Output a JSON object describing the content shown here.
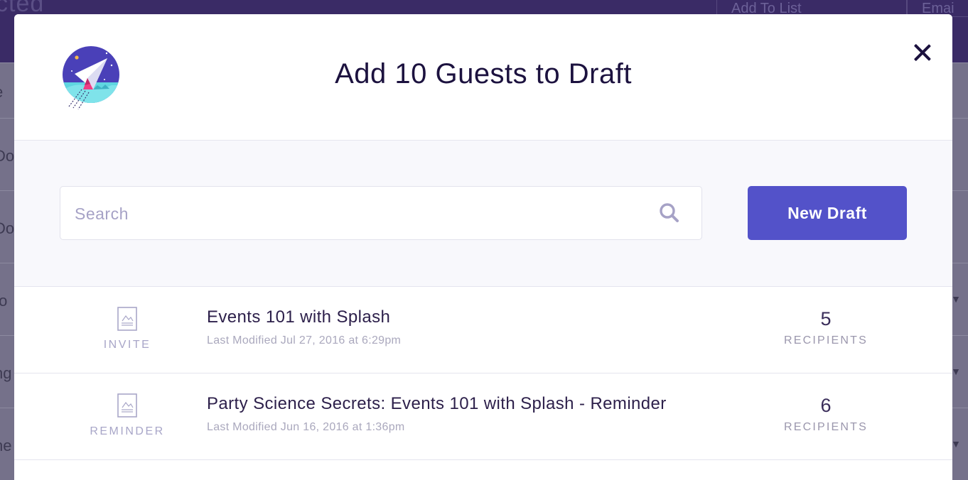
{
  "background": {
    "title_fragment": "cted",
    "add_to_list_button": "Add To List",
    "email_button": "Emai",
    "rows": [
      "e",
      "Do",
      "Do",
      "to",
      "ng",
      "ne"
    ]
  },
  "modal": {
    "title": "Add 10 Guests to Draft",
    "logo_icon": "paper-plane-rocket-icon",
    "close_icon": "close-icon",
    "search": {
      "placeholder": "Search",
      "value": "",
      "icon": "search-icon"
    },
    "new_draft_label": "New Draft",
    "drafts": [
      {
        "type": "INVITE",
        "icon": "document-image-icon",
        "title": "Events 101 with Splash",
        "modified": "Last Modified Jul 27, 2016 at 6:29pm",
        "recipient_count": "5",
        "recipient_label": "RECIPIENTS"
      },
      {
        "type": "REMINDER",
        "icon": "document-image-icon",
        "title": "Party Science Secrets: Events 101 with Splash - Reminder",
        "modified": "Last Modified Jun 16, 2016 at 1:36pm",
        "recipient_count": "6",
        "recipient_label": "RECIPIENTS"
      }
    ]
  },
  "colors": {
    "primary": "#5352c9",
    "title_text": "#1c123f",
    "muted_label": "#a8a6c8",
    "overlay": "#6e6a85"
  }
}
